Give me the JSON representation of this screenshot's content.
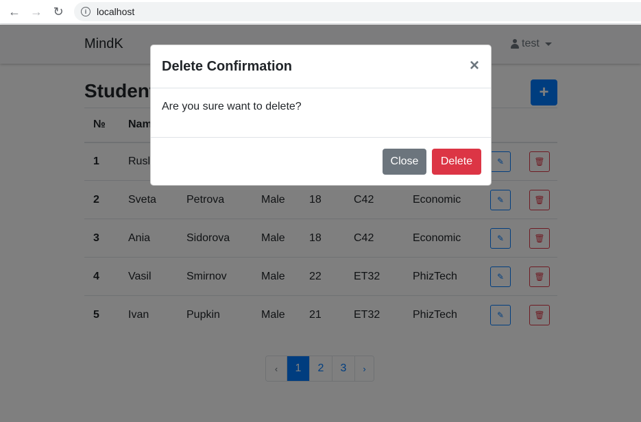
{
  "browser": {
    "url": "localhost"
  },
  "navbar": {
    "brand": "MindK",
    "user": "test"
  },
  "page": {
    "title": "Students",
    "add_label": "+"
  },
  "table": {
    "headers": [
      "№",
      "Name"
    ],
    "rows": [
      {
        "num": "1",
        "name": "Rusla",
        "surname": "",
        "gender": "",
        "age": "",
        "group": "",
        "faculty": ""
      },
      {
        "num": "2",
        "name": "Sveta",
        "surname": "Petrova",
        "gender": "Male",
        "age": "18",
        "group": "C42",
        "faculty": "Economic"
      },
      {
        "num": "3",
        "name": "Ania",
        "surname": "Sidorova",
        "gender": "Male",
        "age": "18",
        "group": "C42",
        "faculty": "Economic"
      },
      {
        "num": "4",
        "name": "Vasil",
        "surname": "Smirnov",
        "gender": "Male",
        "age": "22",
        "group": "ET32",
        "faculty": "PhizTech"
      },
      {
        "num": "5",
        "name": "Ivan",
        "surname": "Pupkin",
        "gender": "Male",
        "age": "21",
        "group": "ET32",
        "faculty": "PhizTech"
      }
    ]
  },
  "pagination": {
    "prev": "‹",
    "pages": [
      "1",
      "2",
      "3"
    ],
    "next": "›",
    "active": "1"
  },
  "modal": {
    "title": "Delete Confirmation",
    "close_icon": "×",
    "body": "Are you sure want to delete?",
    "close_label": "Close",
    "delete_label": "Delete"
  },
  "colors": {
    "primary": "#007bff",
    "danger": "#dc3545",
    "secondary": "#6c757d"
  }
}
